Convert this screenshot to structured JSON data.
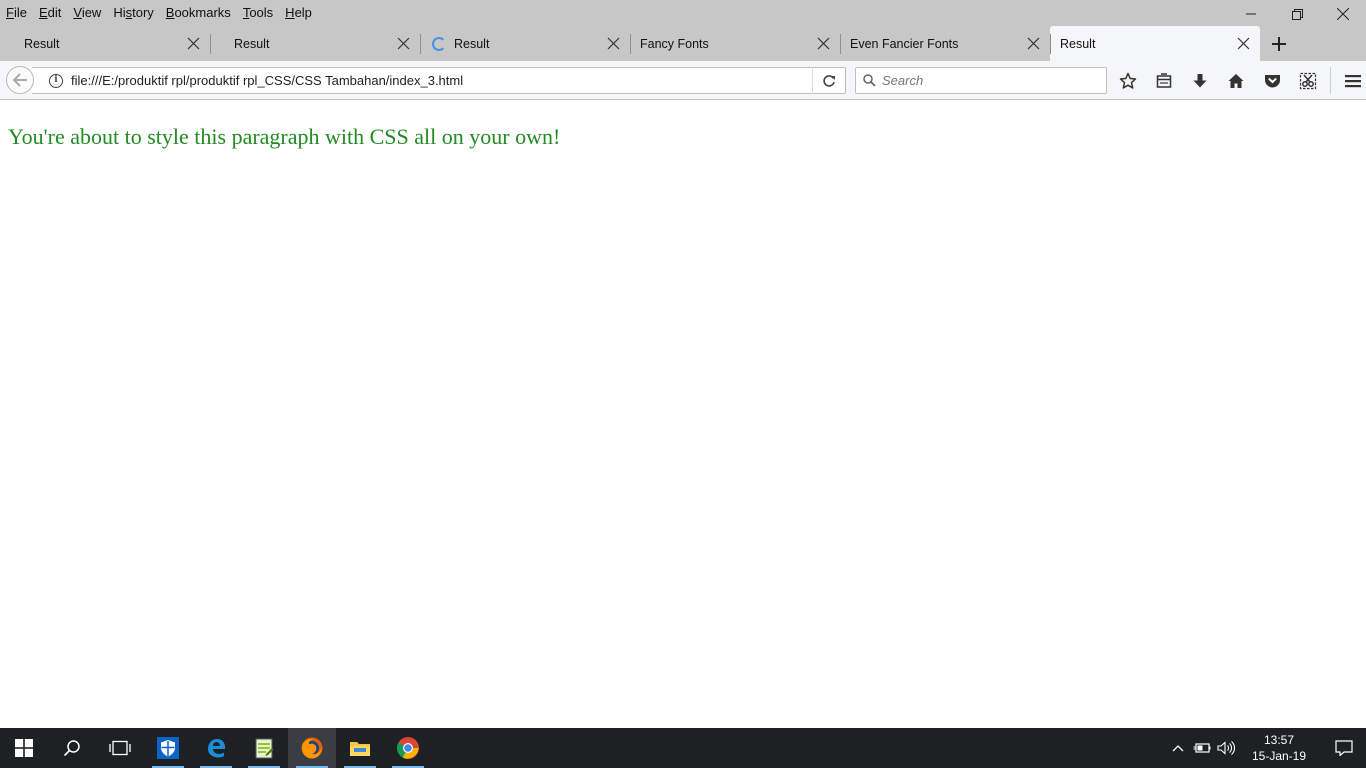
{
  "menu": {
    "items": [
      "File",
      "Edit",
      "View",
      "History",
      "Bookmarks",
      "Tools",
      "Help"
    ],
    "underline_index": [
      0,
      0,
      0,
      2,
      0,
      0,
      0
    ]
  },
  "tabs": [
    {
      "title": "Result",
      "loading": false,
      "active": false
    },
    {
      "title": "Result",
      "loading": false,
      "active": false
    },
    {
      "title": "Result",
      "loading": true,
      "active": false
    },
    {
      "title": "Fancy Fonts",
      "loading": false,
      "active": false
    },
    {
      "title": "Even Fancier Fonts",
      "loading": false,
      "active": false
    },
    {
      "title": "Result",
      "loading": false,
      "active": true
    }
  ],
  "navbar": {
    "url": "file:///E:/produktif rpl/produktif rpl_CSS/CSS Tambahan/index_3.html",
    "search_placeholder": "Search"
  },
  "page": {
    "paragraph": "You're about to style this paragraph with CSS all on your own!",
    "paragraph_color": "#228b22"
  },
  "taskbar": {
    "time": "13:57",
    "date": "15-Jan-19"
  },
  "icons": {
    "window": [
      "minimize-icon",
      "restore-icon",
      "close-icon"
    ],
    "toolbar": [
      "bookmark-star-icon",
      "reading-list-icon",
      "downloads-icon",
      "home-icon",
      "pocket-icon",
      "screenshot-icon",
      "hamburger-menu-icon"
    ]
  }
}
